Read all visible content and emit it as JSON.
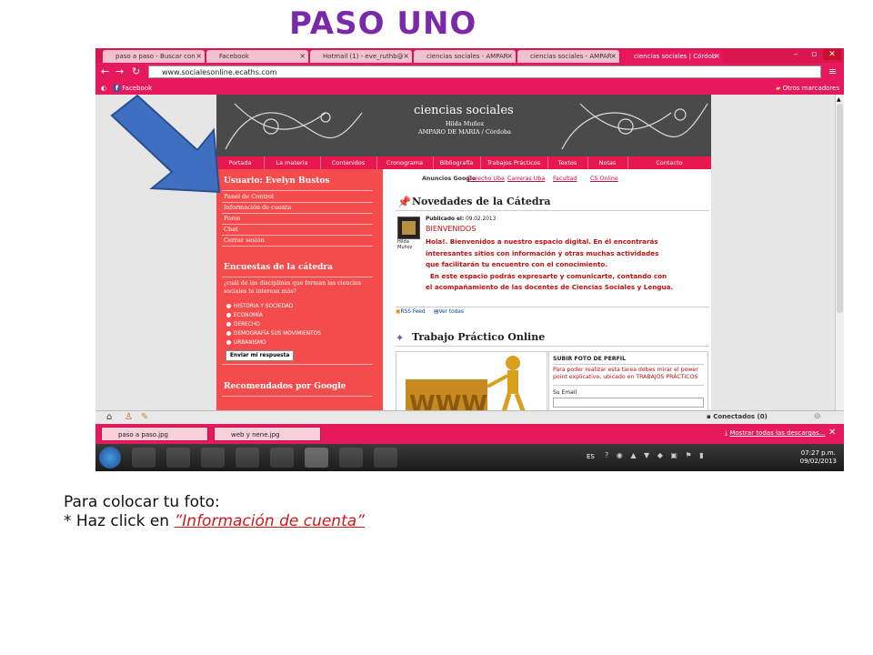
{
  "heading": "PASO UNO",
  "browser": {
    "tabs": [
      {
        "label": "paso a paso - Buscar con"
      },
      {
        "label": "Facebook"
      },
      {
        "label": "Hotmail (1) - eve_ruthb@"
      },
      {
        "label": "ciencias sociales - AMPAR"
      },
      {
        "label": "ciencias sociales - AMPAR"
      },
      {
        "label": "ciencias sociales | Córdob"
      }
    ],
    "url": "www.socialesonline.ecaths.com",
    "bookmark": "Facebook",
    "other_bookmarks": "Otros marcadores"
  },
  "site": {
    "name": "ciencias sociales",
    "author": "Hilda Muñoz",
    "school": "AMPARO DE MARIA / Córdoba",
    "menu": [
      "Portada",
      "La materia",
      "Contenidos",
      "Cronograma",
      "Bibliografía",
      "Trabajos Prácticos",
      "Textos",
      "Notas",
      "Contacto"
    ],
    "user_heading": "Usuario: Evelyn Bustos",
    "user_links": [
      "Panel de Control",
      "Información de cuenta",
      "Foros",
      "Chat",
      "Cerrar sesión"
    ],
    "poll_heading": "Encuestas de la cátedra",
    "poll_question": "¿cuál de las disciplinas que forman las ciencias sociales te interesa más?",
    "poll_options": [
      "HISTORIA Y SOCIEDAD",
      "ECONOMÍA",
      "DERECHO",
      "DEMOGRAFÍA SUS MOVIMIENTOS",
      "URBANISMO"
    ],
    "vote_button": "Enviar mi respuesta",
    "recommended_heading": "Recomendados por Google",
    "ads_label": "Anuncios Google",
    "ads": [
      "Derecho Uba",
      "Carreras Uba",
      "Facultad",
      "CS Online"
    ],
    "news_heading": "Novedades de la Cátedra",
    "avatar_caption": "Hilda Muñoz",
    "published_label": "Publicado el:",
    "published_date": "09.02.2013",
    "post_title": "BIENVENIDOS",
    "post_lines": [
      "Hola!. Bienvenidos a nuestro espacio digital. En él encontrarás",
      "interesantes  sitios con información y otras muchas actividades",
      "que facilitarán  tu encuentro con el conocimiento.",
      "  En este espacio podrás expresarte y comunicarte, contando con",
      "el acompañamiento de las docentes de Ciencias Sociales y Lengua."
    ],
    "rss": "RSS Feed",
    "see_all": "Ver todas",
    "tp_heading": "Trabajo Práctico Online",
    "tp_title": "SUBIR FOTO DE PERFIL",
    "tp_body": "Para poder realizar esta tarea debes mirar el power point explicativo, ubicado en TRABAJOS PRÁCTICOS",
    "tp_email_label": "Su Email"
  },
  "status": {
    "connected": "Conectados (0)"
  },
  "downloads": {
    "items": [
      "paso a paso.jpg",
      "web y nene.jpg"
    ],
    "show_all": "Mostrar todas las descargas..."
  },
  "taskbar": {
    "lang": "ES",
    "time": "07:27 p.m.",
    "date": "09/02/2013"
  },
  "instructions": {
    "line1": "Para colocar tu foto:",
    "line2_prefix": "* Haz click en ",
    "line2_link": "”Información de cuenta”"
  },
  "colors": {
    "accent": "#e5195b",
    "sidebar": "#f44c4c",
    "arrow": "#3f6fc0",
    "heading": "#7a2aa8"
  }
}
